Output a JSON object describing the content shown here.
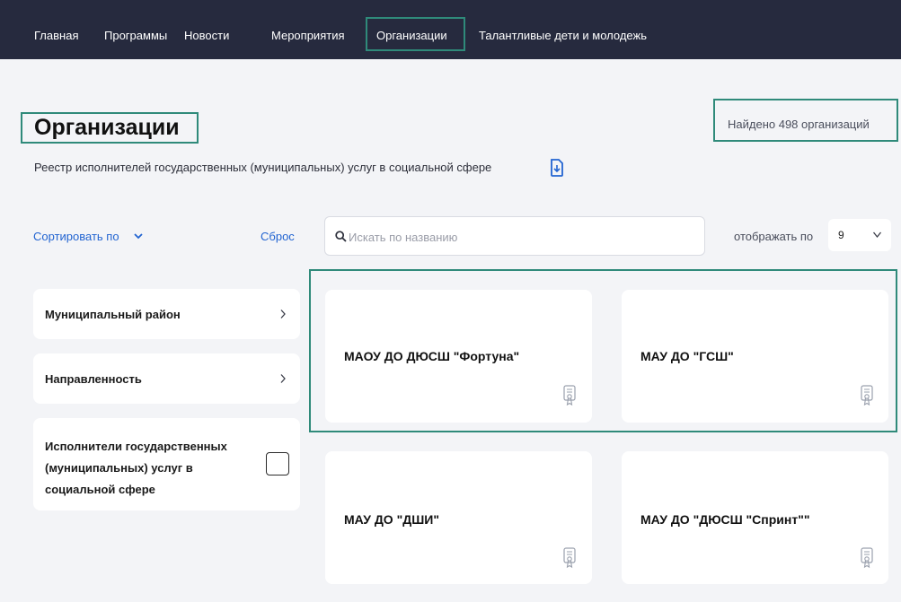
{
  "nav": {
    "items": [
      {
        "label": "Главная"
      },
      {
        "label": "Программы"
      },
      {
        "label": "Новости"
      },
      {
        "label": "Мероприятия"
      },
      {
        "label": "Организации"
      },
      {
        "label": "Талантливые дети и молодежь"
      }
    ],
    "active": "Организации"
  },
  "header": {
    "title": "Организации",
    "found": "Найдено 498 организаций",
    "subtitle": "Реестр исполнителей государственных (муниципальных) услуг в социальной сфере"
  },
  "toolbar": {
    "sort_label": "Сортировать по",
    "reset_label": "Сброс",
    "search_placeholder": "Искать по названию",
    "per_page_label": "отображать по",
    "per_page_value": "9"
  },
  "filters": [
    {
      "label": "Муниципальный район"
    },
    {
      "label": "Направленность"
    },
    {
      "label": "Исполнители государственных (муниципальных) услуг в социальной сфере",
      "checked": false
    }
  ],
  "organizations": [
    {
      "name": "МАОУ ДО ДЮСШ \"Фортуна\""
    },
    {
      "name": "МАУ ДО \"ГСШ\""
    },
    {
      "name": "МАУ ДО \"ДШИ\""
    },
    {
      "name": "МАУ ДО \"ДЮСШ \"Спринт\"\""
    }
  ],
  "colors": {
    "topbar": "#262a3e",
    "accent_outline": "#2f8a7a",
    "link": "#2264d1",
    "page_bg": "#f3f4f7"
  },
  "icons": {
    "document": "document-download-icon",
    "search": "search-icon",
    "certificate": "certificate-icon",
    "chevron": "chevron-icon"
  }
}
